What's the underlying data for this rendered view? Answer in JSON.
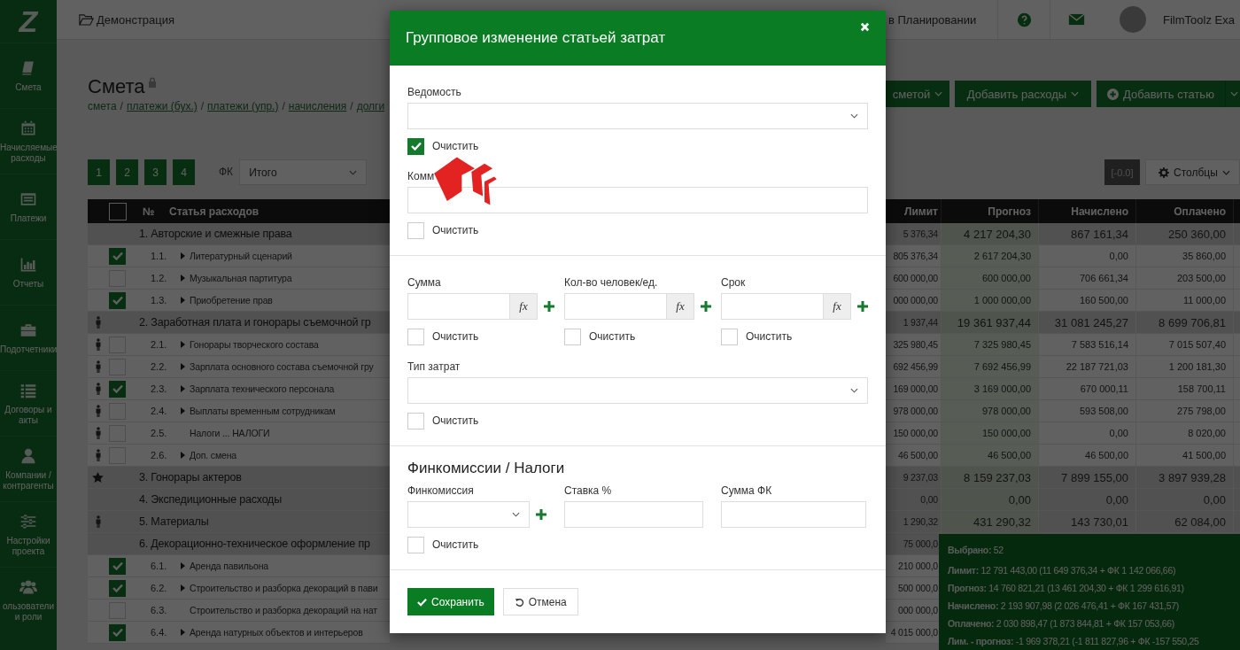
{
  "sidebar": {
    "logo": "Z",
    "items": [
      {
        "label": "Смета"
      },
      {
        "label": "Начисляемые расходы"
      },
      {
        "label": "Платежи"
      },
      {
        "label": "Отчеты"
      },
      {
        "label": "Подотчетники"
      },
      {
        "label": "Договоры и акты"
      },
      {
        "label": "Компании / контрагенты"
      },
      {
        "label": "Настройки проекта"
      },
      {
        "label": "ользователи и роли"
      }
    ]
  },
  "topbar": {
    "project": "Демонстрация",
    "status": "в Планировании",
    "user": "FilmToolz Exa"
  },
  "page": {
    "title": "Смета",
    "breadcrumbs": [
      {
        "label": "смета",
        "link": false
      },
      {
        "label": "/",
        "kind": "separator"
      },
      {
        "label": "платежи (бух.)",
        "link": true
      },
      {
        "label": "/",
        "kind": "separator"
      },
      {
        "label": "платежи (упр.)",
        "link": true
      },
      {
        "label": "/",
        "kind": "separator"
      },
      {
        "label": "начисления",
        "link": true
      },
      {
        "label": "/",
        "kind": "separator"
      },
      {
        "label": "долги",
        "link": true
      }
    ]
  },
  "actions": [
    {
      "label": "сметой",
      "kind": "dropdown"
    },
    {
      "label": "Добавить расходы",
      "kind": "dropdown"
    },
    {
      "label": "Добавить статью",
      "kind": "add"
    }
  ],
  "pager": [
    "1",
    "2",
    "3",
    "4"
  ],
  "fk": {
    "label": "ФК",
    "value": "Итого"
  },
  "precision": "[-0.0]",
  "columns_button": "Столбцы",
  "table": {
    "header_checked": false,
    "number_column": "№",
    "name_column": "Статья расходов",
    "value_columns": [
      "Лимит",
      "Прогноз",
      "Начислено",
      "Оплачено"
    ],
    "rows": [
      {
        "kind": "group",
        "staff": false,
        "starred": false,
        "name": "1. Авторские и смежные права",
        "values": [
          "5 376,34",
          "4 217 204,30",
          "867 161,34",
          "250 360,00"
        ]
      },
      {
        "kind": "item",
        "staff": false,
        "starred": false,
        "checked": true,
        "number": "1.1.",
        "expandable": true,
        "name": "Литературный сценарий",
        "values": [
          "805 376,34",
          "2 617 204,30",
          "0,00",
          "35 860,00"
        ]
      },
      {
        "kind": "item",
        "staff": false,
        "starred": false,
        "checked": false,
        "number": "1.2.",
        "expandable": true,
        "name": "Музыкальная партитура",
        "values": [
          "600 000,00",
          "600 000,00",
          "706 661,34",
          "203 500,00"
        ]
      },
      {
        "kind": "item",
        "staff": false,
        "starred": false,
        "checked": true,
        "number": "1.3.",
        "expandable": true,
        "name": "Приобретение прав",
        "values": [
          "000 000,00",
          "1 000 000,00",
          "160 500,00",
          "11 000,00"
        ]
      },
      {
        "kind": "group",
        "staff": true,
        "starred": false,
        "name": "2. Заработная плата и гонорары съемочной гр",
        "values": [
          "1 937,44",
          "19 361 937,44",
          "31 081 245,27",
          "8 699 706,81"
        ]
      },
      {
        "kind": "item",
        "staff": true,
        "starred": false,
        "checked": false,
        "number": "2.1.",
        "expandable": true,
        "name": "Гонорары творческого состава",
        "values": [
          "325 980,45",
          "7 325 980,45",
          "7 583 516,14",
          "7 015 507,40"
        ]
      },
      {
        "kind": "item",
        "staff": true,
        "starred": false,
        "checked": false,
        "number": "2.2.",
        "expandable": true,
        "name": "Зарплата основного состава съемочной гру",
        "values": [
          "692 456,99",
          "7 692 456,99",
          "22 187 721,03",
          "1 200 181,30"
        ]
      },
      {
        "kind": "item",
        "staff": true,
        "starred": false,
        "checked": true,
        "number": "2.3.",
        "expandable": true,
        "name": "Зарплата технического персонала",
        "values": [
          "169 000,00",
          "3 169 000,00",
          "670 000,11",
          "158 700,11"
        ]
      },
      {
        "kind": "item",
        "staff": true,
        "starred": false,
        "checked": false,
        "number": "2.4.",
        "expandable": true,
        "name": "Выплаты временным сотрудникам",
        "values": [
          "978 000,00",
          "978 000,00",
          "593 508,00",
          "275 798,00"
        ]
      },
      {
        "kind": "item",
        "staff": true,
        "starred": false,
        "checked": false,
        "number": "2.5.",
        "expandable": false,
        "name": "Налоги ... НАЛОГИ",
        "values": [
          "150 000,00",
          "150 000,00",
          "0,00",
          "8 020,00"
        ]
      },
      {
        "kind": "item",
        "staff": true,
        "starred": false,
        "checked": false,
        "number": "2.6.",
        "expandable": true,
        "name": "Доп. смена",
        "values": [
          "46 500,00",
          "46 500,00",
          "46 500,00",
          "41 500,00"
        ]
      },
      {
        "kind": "group",
        "staff": false,
        "starred": true,
        "name": "3. Гонорары актеров",
        "values": [
          "9 237,03",
          "8 159 237,03",
          "7 899 155,00",
          "3 897 939,28"
        ]
      },
      {
        "kind": "group",
        "staff": false,
        "starred": false,
        "name": "4. Экспедиционные расходы",
        "values": [
          "0,00",
          "0,00",
          "0,00",
          "0,00"
        ]
      },
      {
        "kind": "group",
        "staff": true,
        "starred": false,
        "name": "5. Материалы",
        "values": [
          "1 290,32",
          "431 290,32",
          "143 730,01",
          "62 084,00"
        ]
      },
      {
        "kind": "group",
        "staff": false,
        "starred": false,
        "name": "6. Декорационно-техническое оформление пр",
        "values": [
          "75 000,0"
        ]
      },
      {
        "kind": "item",
        "staff": false,
        "starred": false,
        "checked": true,
        "number": "6.1.",
        "expandable": true,
        "name": "Аренда павильона",
        "values": [
          "210 000,0"
        ]
      },
      {
        "kind": "item",
        "staff": false,
        "starred": false,
        "checked": true,
        "number": "6.2.",
        "expandable": true,
        "name": "Строительство и разборка декораций в пави",
        "values": [
          "500 000,0"
        ]
      },
      {
        "kind": "item",
        "staff": false,
        "starred": false,
        "checked": false,
        "number": "6.3.",
        "expandable": false,
        "name": "Строительство и разборка декораций на нат",
        "values": [
          "000 000,0"
        ]
      },
      {
        "kind": "item",
        "staff": false,
        "starred": false,
        "checked": true,
        "number": "6.4.",
        "expandable": true,
        "name": "Аренда натурных объектов и интерьеров",
        "values": [
          "4 015 000,0"
        ]
      }
    ]
  },
  "summary": {
    "lines": [
      {
        "label": "Выбрано:",
        "value": "52"
      },
      {
        "label": "Лимит:",
        "value": "12 791 443,00 (11 649 376,34 + ФК 1 142 066,66)"
      },
      {
        "label": "Прогноз:",
        "value": "14 760 821,21 (13 461 204,30 + ФК 1 299 616,91)"
      },
      {
        "label": "Начислено:",
        "value": "2 193 907,98 (2 026 476,41 + ФК 167 431,57)"
      },
      {
        "label": "Оплачено:",
        "value": "2 030 898,47 (1 873 844,81 + ФК 157 053,66)"
      },
      {
        "label": "Лим. - прогноз:",
        "value": "-1 969 378,21 (-1 811 827,96 + ФК -157 550,25"
      }
    ]
  },
  "modal": {
    "title": "Групповое изменение статьей затрат",
    "statement": {
      "label": "Ведомость",
      "clear": {
        "label": "Очистить",
        "checked": true
      }
    },
    "comment": {
      "label": "Комм",
      "clear": {
        "label": "Очистить",
        "checked": false
      }
    },
    "amounts": [
      {
        "label": "Сумма",
        "addon": "fx",
        "clear": {
          "label": "Очистить",
          "checked": false
        }
      },
      {
        "label": "Кол-во человек/ед.",
        "addon": "fx",
        "clear": {
          "label": "Очистить",
          "checked": false
        }
      },
      {
        "label": "Срок",
        "addon": "fx",
        "clear": {
          "label": "Очистить",
          "checked": false
        }
      }
    ],
    "cost_type": {
      "label": "Тип затрат",
      "clear": {
        "label": "Очистить",
        "checked": false
      }
    },
    "fees": {
      "heading": "Финкомиссии / Налоги",
      "fee_label": "Финкомиссия",
      "rate_label": "Ставка %",
      "sum_label": "Сумма ФК",
      "clear": {
        "label": "Очистить",
        "checked": false
      }
    },
    "buttons": [
      {
        "label": "Сохранить",
        "kind": "primary"
      },
      {
        "label": "Отмена",
        "kind": "cancel"
      }
    ]
  }
}
